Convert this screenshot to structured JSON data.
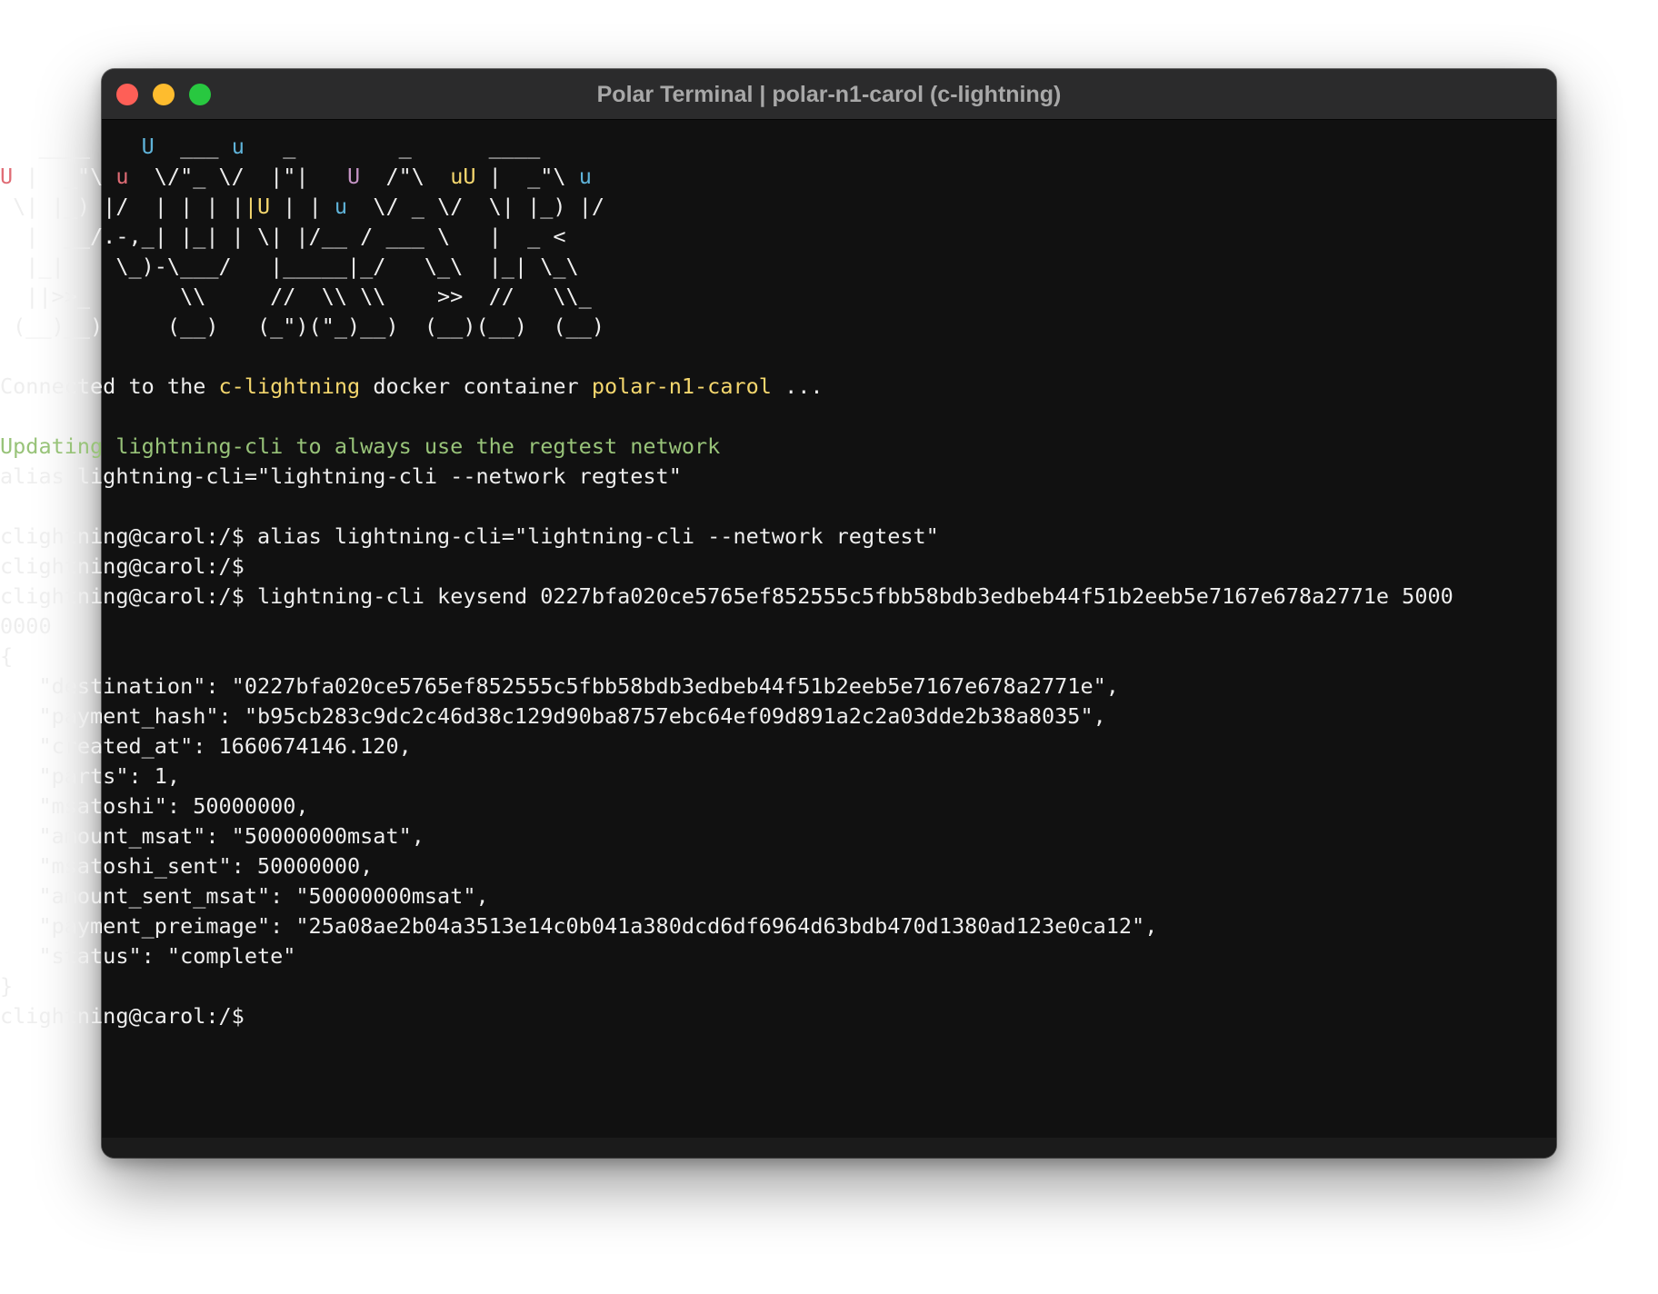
{
  "window": {
    "title": "Polar Terminal | polar-n1-carol (c-lightning)"
  },
  "colors": {
    "terminal_background": "#111111",
    "text": "#eeeeee",
    "highlight_yellow": "#f5d76e",
    "info_green": "#98c379",
    "ascii_red": "#e06c75",
    "ascii_blue": "#5fb3d9",
    "ascii_purple": "#c594c5"
  },
  "banner": {
    "lines": [
      [
        {
          "t": "   ____    "
        },
        {
          "t": "U",
          "c": "blue"
        },
        {
          "t": "  ___ "
        },
        {
          "t": "u",
          "c": "blue"
        },
        {
          "t": "   _        _      ____"
        }
      ],
      [
        {
          "t": "U",
          "c": "red"
        },
        {
          "t": " |  _\"\\ "
        },
        {
          "t": "u",
          "c": "red"
        },
        {
          "t": "  \\/\"_ \\/  |\"|   "
        },
        {
          "t": "U",
          "c": "purple"
        },
        {
          "t": "  /\"\\  "
        },
        {
          "t": "uU",
          "c": "yellow"
        },
        {
          "t": " |  _\"\\ "
        },
        {
          "t": "u",
          "c": "blue"
        }
      ],
      [
        {
          "t": " \\| |_) |/  | | | |"
        },
        {
          "t": "|U",
          "c": "yellow"
        },
        {
          "t": " | | "
        },
        {
          "t": "u",
          "c": "blue"
        },
        {
          "t": "  \\/ _ \\/  \\| |_) |/"
        }
      ],
      [
        {
          "t": "  |  __/.-,_| |_| | \\| |/__ / ___ \\   |  _ <"
        }
      ],
      [
        {
          "t": "  |_|    \\_)-\\___/   |_____|_/   \\_\\  |_| \\_\\"
        }
      ],
      [
        {
          "t": "  ||>>_       \\\\     //  \\\\ \\\\    >>  //   \\\\_"
        }
      ],
      [
        {
          "t": " (__)__)     (__)   (_\")(\"_)__)  (__)(__)  (__)"
        }
      ]
    ]
  },
  "session": {
    "connected": {
      "prefix": "Connected to the ",
      "node_impl": "c-lightning",
      "middle": " docker container ",
      "container": "polar-n1-carol",
      "suffix": " ..."
    },
    "updating_notice": "Updating lightning-cli to always use the regtest network",
    "alias_echo": "alias lightning-cli=\"lightning-cli --network regtest\"",
    "prompt": "clightning@carol:/$",
    "cmd_alias": " alias lightning-cli=\"lightning-cli --network regtest\"",
    "cmd_keysend_line1": " lightning-cli keysend 0227bfa020ce5765ef852555c5fbb58bdb3edbeb44f51b2eeb5e7167e678a2771e 5000",
    "cmd_keysend_line2": "0000"
  },
  "keysend_result": {
    "open_brace": "{",
    "close_brace": "}",
    "fields": [
      "   \"destination\": \"0227bfa020ce5765ef852555c5fbb58bdb3edbeb44f51b2eeb5e7167e678a2771e\",",
      "   \"payment_hash\": \"b95cb283c9dc2c46d38c129d90ba8757ebc64ef09d891a2c2a03dde2b38a8035\",",
      "   \"created_at\": 1660674146.120,",
      "   \"parts\": 1,",
      "   \"msatoshi\": 50000000,",
      "   \"amount_msat\": \"50000000msat\",",
      "   \"msatoshi_sent\": 50000000,",
      "   \"amount_sent_msat\": \"50000000msat\",",
      "   \"payment_preimage\": \"25a08ae2b04a3513e14c0b041a380dcd6df6964d63bdb470d1380ad123e0ca12\",",
      "   \"status\": \"complete\""
    ]
  }
}
